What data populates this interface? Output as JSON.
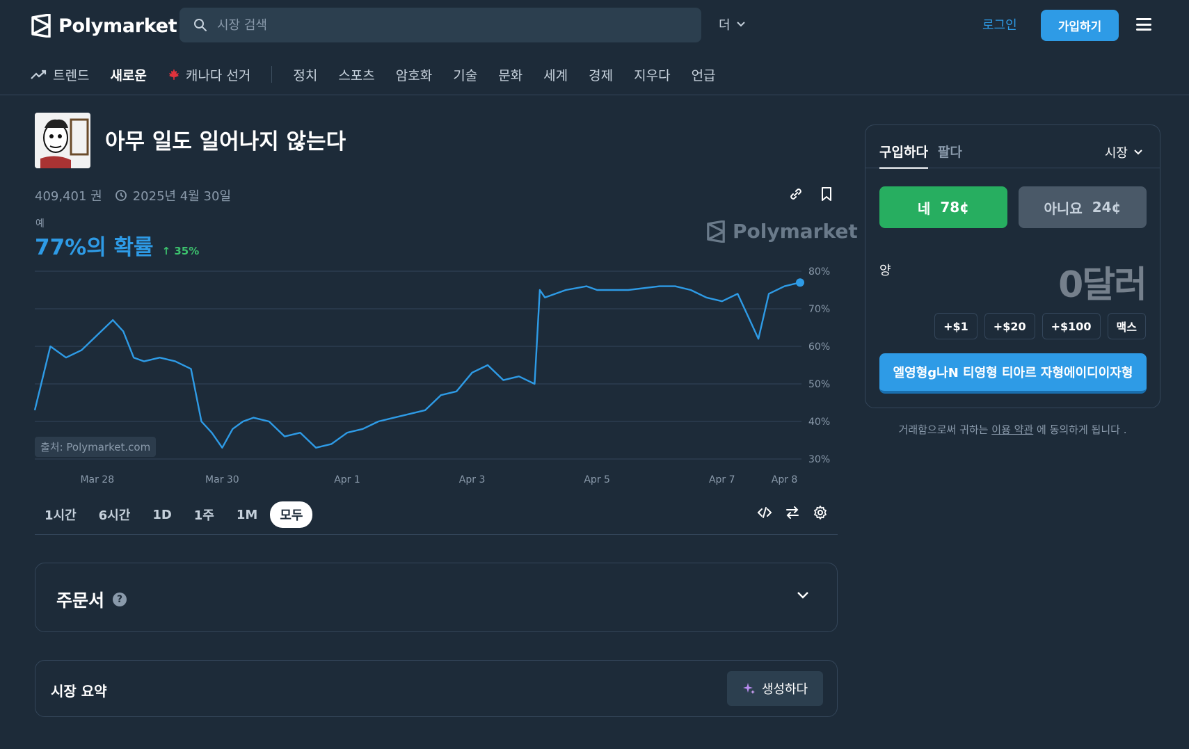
{
  "header": {
    "logo_text": "Polymarket",
    "search_placeholder": "시장 검색",
    "more_label": "더",
    "login_label": "로그인",
    "signup_label": "가입하기"
  },
  "nav": {
    "items": [
      {
        "label": "트렌드",
        "icon": "trending-icon"
      },
      {
        "label": "새로운",
        "active": true
      },
      {
        "label": "캐나다 선거",
        "icon": "maple-leaf-icon"
      },
      {
        "label": "정치"
      },
      {
        "label": "스포츠"
      },
      {
        "label": "암호화"
      },
      {
        "label": "기술"
      },
      {
        "label": "문화"
      },
      {
        "label": "세계"
      },
      {
        "label": "경제"
      },
      {
        "label": "지우다"
      },
      {
        "label": "언급"
      }
    ]
  },
  "market": {
    "title": "아무 일도 일어나지 않는다",
    "volume": "409,401 권",
    "end_date": "2025년 4월 30일",
    "outcome_label": "예",
    "probability": "77%의 확률",
    "change": "35%",
    "watermark": "Polymarket",
    "source": "출처: Polymarket.com"
  },
  "time_ranges": [
    "1시간",
    "6시간",
    "1D",
    "1주",
    "1M",
    "모두"
  ],
  "active_range": "모두",
  "order_book": {
    "title": "주문서",
    "help": "?"
  },
  "summary": {
    "title": "시장 요약",
    "generate_label": "생성하다"
  },
  "trade": {
    "tab_buy": "구입하다",
    "tab_sell": "팔다",
    "order_type": "시장",
    "yes_label": "네",
    "yes_price": "78¢",
    "no_label": "아니요",
    "no_price": "24¢",
    "amount_label": "양",
    "amount_value": "0달러",
    "quick_amounts": [
      "+$1",
      "+$20",
      "+$100",
      "맥스"
    ],
    "button_label": "엘영형g나N 티영형 티아르 자형에이디이자형",
    "terms_prefix": "거래함으로써 귀하는 ",
    "terms_link": "이용 약관",
    "terms_suffix": " 에 동의하게 됩니다 ."
  },
  "colors": {
    "background": "#1d2b39",
    "accent": "#2e9be6",
    "yes": "#27ae60",
    "no": "#4a5968"
  },
  "chart_data": {
    "type": "line",
    "series": [
      {
        "x": [
          "2025-03-27T00:00",
          "2025-03-27T06:00",
          "2025-03-27T12:00",
          "2025-03-27T18:00",
          "2025-03-28T00:00",
          "2025-03-28T06:00",
          "2025-03-28T10:00",
          "2025-03-28T14:00",
          "2025-03-28T18:00",
          "2025-03-29T00:00",
          "2025-03-29T06:00",
          "2025-03-29T12:00",
          "2025-03-29T16:00",
          "2025-03-29T20:00",
          "2025-03-30T00:00",
          "2025-03-30T04:00",
          "2025-03-30T08:00",
          "2025-03-30T12:00",
          "2025-03-30T18:00",
          "2025-03-31T00:00",
          "2025-03-31T06:00",
          "2025-03-31T12:00",
          "2025-03-31T18:00",
          "2025-04-01T00:00",
          "2025-04-01T06:00",
          "2025-04-01T12:00",
          "2025-04-01T18:00",
          "2025-04-02T00:00",
          "2025-04-02T06:00",
          "2025-04-02T12:00",
          "2025-04-02T18:00",
          "2025-04-03T00:00",
          "2025-04-03T06:00",
          "2025-04-03T12:00",
          "2025-04-03T18:00",
          "2025-04-04T00:00",
          "2025-04-04T02:00",
          "2025-04-04T04:00",
          "2025-04-04T12:00",
          "2025-04-04T20:00",
          "2025-04-05T00:00",
          "2025-04-05T12:00",
          "2025-04-06T00:00",
          "2025-04-06T06:00",
          "2025-04-06T12:00",
          "2025-04-06T18:00",
          "2025-04-07T00:00",
          "2025-04-07T06:00",
          "2025-04-07T10:00",
          "2025-04-07T14:00",
          "2025-04-07T18:00",
          "2025-04-08T00:00",
          "2025-04-08T06:00"
        ],
        "values": [
          43,
          60,
          57,
          59,
          63,
          67,
          64,
          57,
          56,
          57,
          56,
          54,
          40,
          37,
          33,
          38,
          40,
          41,
          40,
          36,
          37,
          33,
          34,
          37,
          38,
          40,
          41,
          42,
          43,
          47,
          48,
          53,
          55,
          51,
          52,
          50,
          75,
          73,
          75,
          76,
          75,
          75,
          76,
          76,
          75,
          73,
          72,
          74,
          68,
          62,
          74,
          76,
          77
        ]
      }
    ],
    "ylim": [
      30,
      80
    ],
    "yticks": [
      "80%",
      "70%",
      "60%",
      "50%",
      "40%",
      "30%"
    ],
    "xticks": [
      "Mar 28",
      "Mar 30",
      "Apr 1",
      "Apr 3",
      "Apr 5",
      "Apr 7",
      "Apr 8"
    ],
    "grid": true
  }
}
